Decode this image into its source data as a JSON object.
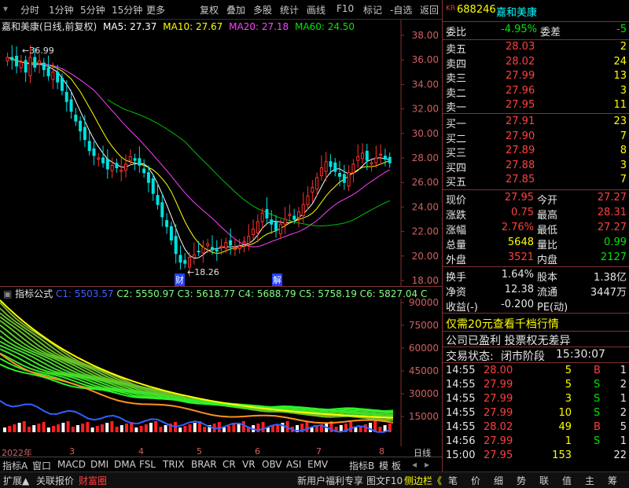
{
  "toolbar": {
    "left_tabs": [
      "分时",
      "1分钟",
      "5分钟",
      "15分钟",
      "更多"
    ],
    "right_tabs": [
      "复权",
      "叠加",
      "多股",
      "统计",
      "画线",
      "F10",
      "标记",
      "-自选",
      "返回"
    ]
  },
  "chart": {
    "title": "嘉和美康(日线,前复权)",
    "ma": [
      {
        "label": "MA5: 27.37",
        "color": "#ffffff"
      },
      {
        "label": "MA10: 27.67",
        "color": "#ffff00"
      },
      {
        "label": "MA20: 27.18",
        "color": "#ff40ff"
      },
      {
        "label": "MA60: 24.50",
        "color": "#00e600"
      }
    ],
    "y_ticks": [
      "38.00",
      "36.00",
      "34.00",
      "32.00",
      "30.00",
      "28.00",
      "26.00",
      "24.00",
      "22.00",
      "20.00",
      "18.00"
    ],
    "high_label": "36.99",
    "low_label": "18.26",
    "marker_cai": "财",
    "marker_jie": "解"
  },
  "indicator": {
    "title": "指标公式",
    "values": [
      {
        "label": "C1: 5503.57",
        "color": "#4040ff"
      },
      {
        "label": "C2: 5550.97",
        "color": "#80ff80"
      },
      {
        "label": "C3: 5618.77",
        "color": "#80ff80"
      },
      {
        "label": "C4: 5688.79",
        "color": "#80ff80"
      },
      {
        "label": "C5: 5758.19",
        "color": "#80ff80"
      },
      {
        "label": "C6: 5827.04",
        "color": "#80ff80"
      },
      {
        "label": "C",
        "color": "#80ff80"
      }
    ],
    "y_ticks": [
      "90000",
      "75000",
      "60000",
      "45000",
      "30000",
      "15000"
    ],
    "x_labels": [
      "2022年",
      "3",
      "4",
      "5",
      "6",
      "7",
      "8"
    ],
    "period": "日线"
  },
  "ind_tabs": [
    "指标A",
    "窗口",
    "MACD",
    "DMI",
    "DMA",
    "FSL",
    "TRIX",
    "BRAR",
    "CR",
    "VR",
    "OBV",
    "ASI",
    "EMV",
    "指标B",
    "模",
    "板"
  ],
  "bottom": {
    "left": [
      "扩展▲",
      "关联报价",
      "财富圈"
    ],
    "middle": [
      "新用户福利专享",
      "图文F10",
      "侧边栏《"
    ],
    "right": [
      "笔",
      "价",
      "细",
      "势",
      "联",
      "值",
      "主",
      "筹"
    ]
  },
  "quote": {
    "code": "688246",
    "name": "嘉和美康",
    "wei_bi_label": "委比",
    "wei_bi": "-4.95%",
    "wei_cha_label": "委差",
    "wei_cha": "-5",
    "sell": [
      {
        "label": "卖五",
        "price": "28.03",
        "vol": "2"
      },
      {
        "label": "卖四",
        "price": "28.02",
        "vol": "24"
      },
      {
        "label": "卖三",
        "price": "27.99",
        "vol": "13"
      },
      {
        "label": "卖二",
        "price": "27.96",
        "vol": "3"
      },
      {
        "label": "卖一",
        "price": "27.95",
        "vol": "11"
      }
    ],
    "buy": [
      {
        "label": "买一",
        "price": "27.91",
        "vol": "23"
      },
      {
        "label": "买二",
        "price": "27.90",
        "vol": "7"
      },
      {
        "label": "买三",
        "price": "27.89",
        "vol": "8"
      },
      {
        "label": "买四",
        "price": "27.88",
        "vol": "3"
      },
      {
        "label": "买五",
        "price": "27.85",
        "vol": "7"
      }
    ],
    "stats": [
      {
        "l1": "现价",
        "v1": "27.95",
        "c1": "red",
        "l2": "今开",
        "v2": "27.27",
        "c2": "red"
      },
      {
        "l1": "涨跌",
        "v1": "0.75",
        "c1": "red",
        "l2": "最高",
        "v2": "28.31",
        "c2": "red"
      },
      {
        "l1": "涨幅",
        "v1": "2.76%",
        "c1": "red",
        "l2": "最低",
        "v2": "27.27",
        "c2": "red"
      },
      {
        "l1": "总量",
        "v1": "5648",
        "c1": "yellow",
        "l2": "量比",
        "v2": "0.99",
        "c2": "green"
      },
      {
        "l1": "外盘",
        "v1": "3521",
        "c1": "red",
        "l2": "内盘",
        "v2": "2127",
        "c2": "green"
      }
    ],
    "stats2": [
      {
        "l1": "换手",
        "v1": "1.64%",
        "l2": "股本",
        "v2": "1.38亿"
      },
      {
        "l1": "净资",
        "v1": "12.38",
        "l2": "流通",
        "v2": "3447万"
      },
      {
        "l1": "收益(-)",
        "v1": "-0.200",
        "l2": "PE(动)",
        "v2": ""
      }
    ],
    "promo": "仅需20元查看千档行情",
    "info": "公司已盈利 投票权无差异",
    "status_label": "交易状态:",
    "status": "闭市阶段",
    "status_time": "15:30:07",
    "ticks": [
      {
        "t": "14:55",
        "p": "28.00",
        "v": "5",
        "bs": "B",
        "n": "1"
      },
      {
        "t": "14:55",
        "p": "27.99",
        "v": "5",
        "bs": "S",
        "n": "2"
      },
      {
        "t": "14:55",
        "p": "27.99",
        "v": "3",
        "bs": "S",
        "n": "1"
      },
      {
        "t": "14:55",
        "p": "27.99",
        "v": "10",
        "bs": "S",
        "n": "2"
      },
      {
        "t": "14:55",
        "p": "28.02",
        "v": "49",
        "bs": "B",
        "n": "5"
      },
      {
        "t": "14:56",
        "p": "27.99",
        "v": "1",
        "bs": "S",
        "n": "1"
      },
      {
        "t": "15:00",
        "p": "27.95",
        "v": "153",
        "bs": "",
        "n": "22"
      }
    ]
  }
}
